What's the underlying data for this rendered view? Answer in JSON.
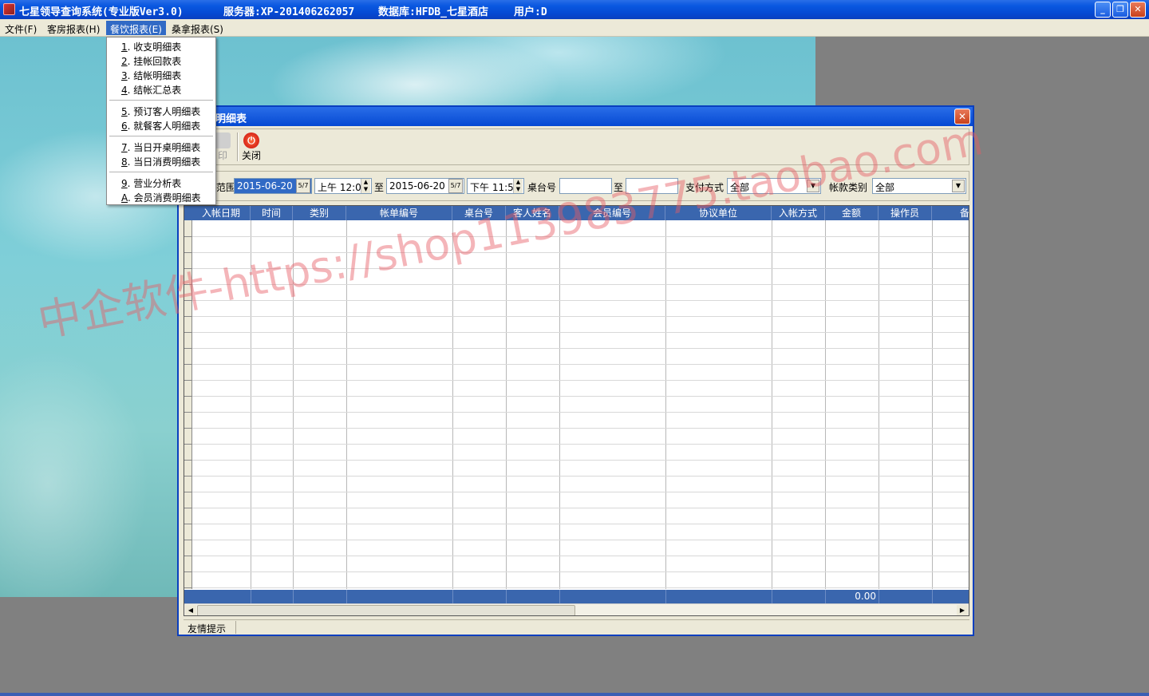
{
  "titlebar": {
    "app_name": "七星领导查询系统(专业版Ver3.0)",
    "server": "服务器:XP-201406262057",
    "database": "数据库:HFDB_七星酒店",
    "user": "用户:D",
    "minimize_glyph": "_",
    "restore_glyph": "❐",
    "close_glyph": "✕"
  },
  "menubar": {
    "items": [
      "文件(F)",
      "客房报表(H)",
      "餐饮报表(E)",
      "桑拿报表(S)"
    ]
  },
  "dropdown": {
    "group1": [
      {
        "key": "1",
        "label": "收支明细表"
      },
      {
        "key": "2",
        "label": "挂帐回款表"
      },
      {
        "key": "3",
        "label": "结帐明细表"
      },
      {
        "key": "4",
        "label": "结帐汇总表"
      }
    ],
    "group2": [
      {
        "key": "5",
        "label": "预订客人明细表"
      },
      {
        "key": "6",
        "label": "就餐客人明细表"
      }
    ],
    "group3": [
      {
        "key": "7",
        "label": "当日开桌明细表"
      },
      {
        "key": "8",
        "label": "当日消费明细表"
      }
    ],
    "group4": [
      {
        "key": "9",
        "label": "营业分析表"
      },
      {
        "key": "A",
        "label": "会员消费明细表"
      }
    ]
  },
  "child_window": {
    "title": "明细表",
    "close_glyph": "✕",
    "toolbar": {
      "print_label": "印",
      "close_label": "关闭",
      "close_icon_glyph": "⏻"
    },
    "filter": {
      "range_label": "范围",
      "start_date": "2015-06-20",
      "start_time": "上午 12:0",
      "to_label_1": "至",
      "end_date": "2015-06-20",
      "end_time": "下午 11:5",
      "table_no_label": "桌台号",
      "table_no_from": "",
      "to_label_2": "至",
      "table_no_to": "",
      "payment_label": "支付方式",
      "payment_value": "全部",
      "account_type_label": "帐款类别",
      "account_type_value": "全部",
      "cal_glyph": "5/7",
      "combo_glyph": "▼",
      "spin_up": "▲",
      "spin_down": "▼"
    },
    "grid": {
      "columns": [
        "入帐日期",
        "时间",
        "类别",
        "帐单编号",
        "桌台号",
        "客人姓名",
        "会员编号",
        "协议单位",
        "入帐方式",
        "金额",
        "操作员",
        "备"
      ],
      "rows": [],
      "total_amount": "0.00",
      "scroll_left": "◀",
      "scroll_right": "▶"
    },
    "status": {
      "tip": "友情提示"
    }
  },
  "watermark": "中企软件-https://shop113983775.taobao.com"
}
